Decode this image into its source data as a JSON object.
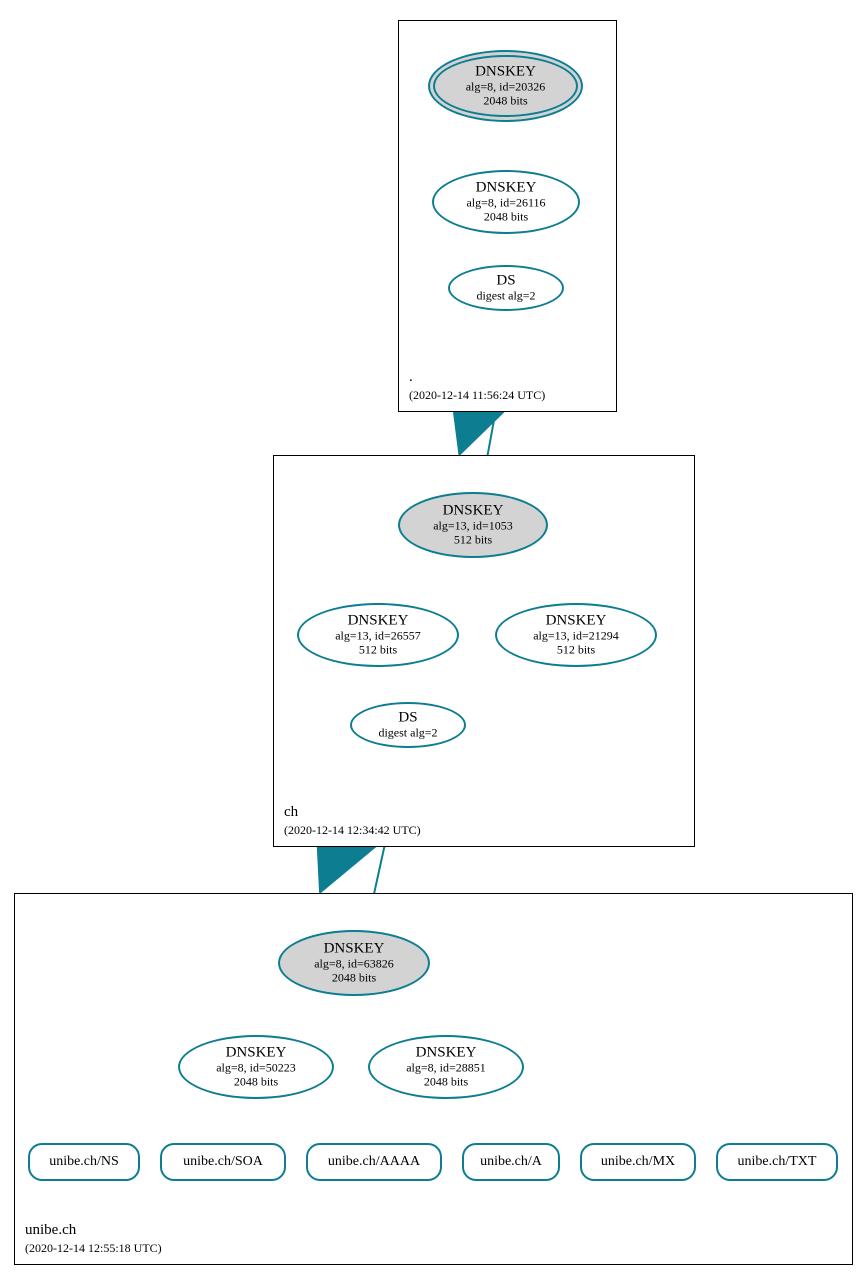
{
  "colors": {
    "stroke": "#0d7d92"
  },
  "zones": {
    "root": {
      "name": ".",
      "ts": "(2020-12-14 11:56:24 UTC)"
    },
    "ch": {
      "name": "ch",
      "ts": "(2020-12-14 12:34:42 UTC)"
    },
    "unibe": {
      "name": "unibe.ch",
      "ts": "(2020-12-14 12:55:18 UTC)"
    }
  },
  "root": {
    "ksk": {
      "title": "DNSKEY",
      "line1": "alg=8, id=20326",
      "line2": "2048 bits"
    },
    "zsk": {
      "title": "DNSKEY",
      "line1": "alg=8, id=26116",
      "line2": "2048 bits"
    },
    "ds": {
      "title": "DS",
      "line1": "digest alg=2"
    }
  },
  "ch": {
    "ksk": {
      "title": "DNSKEY",
      "line1": "alg=13, id=1053",
      "line2": "512 bits"
    },
    "zsk1": {
      "title": "DNSKEY",
      "line1": "alg=13, id=26557",
      "line2": "512 bits"
    },
    "zsk2": {
      "title": "DNSKEY",
      "line1": "alg=13, id=21294",
      "line2": "512 bits"
    },
    "ds": {
      "title": "DS",
      "line1": "digest alg=2"
    }
  },
  "unibe": {
    "ksk": {
      "title": "DNSKEY",
      "line1": "alg=8, id=63826",
      "line2": "2048 bits"
    },
    "zsk1": {
      "title": "DNSKEY",
      "line1": "alg=8, id=50223",
      "line2": "2048 bits"
    },
    "zsk2": {
      "title": "DNSKEY",
      "line1": "alg=8, id=28851",
      "line2": "2048 bits"
    },
    "rr": {
      "ns": "unibe.ch/NS",
      "soa": "unibe.ch/SOA",
      "aaaa": "unibe.ch/AAAA",
      "a": "unibe.ch/A",
      "mx": "unibe.ch/MX",
      "txt": "unibe.ch/TXT"
    }
  }
}
